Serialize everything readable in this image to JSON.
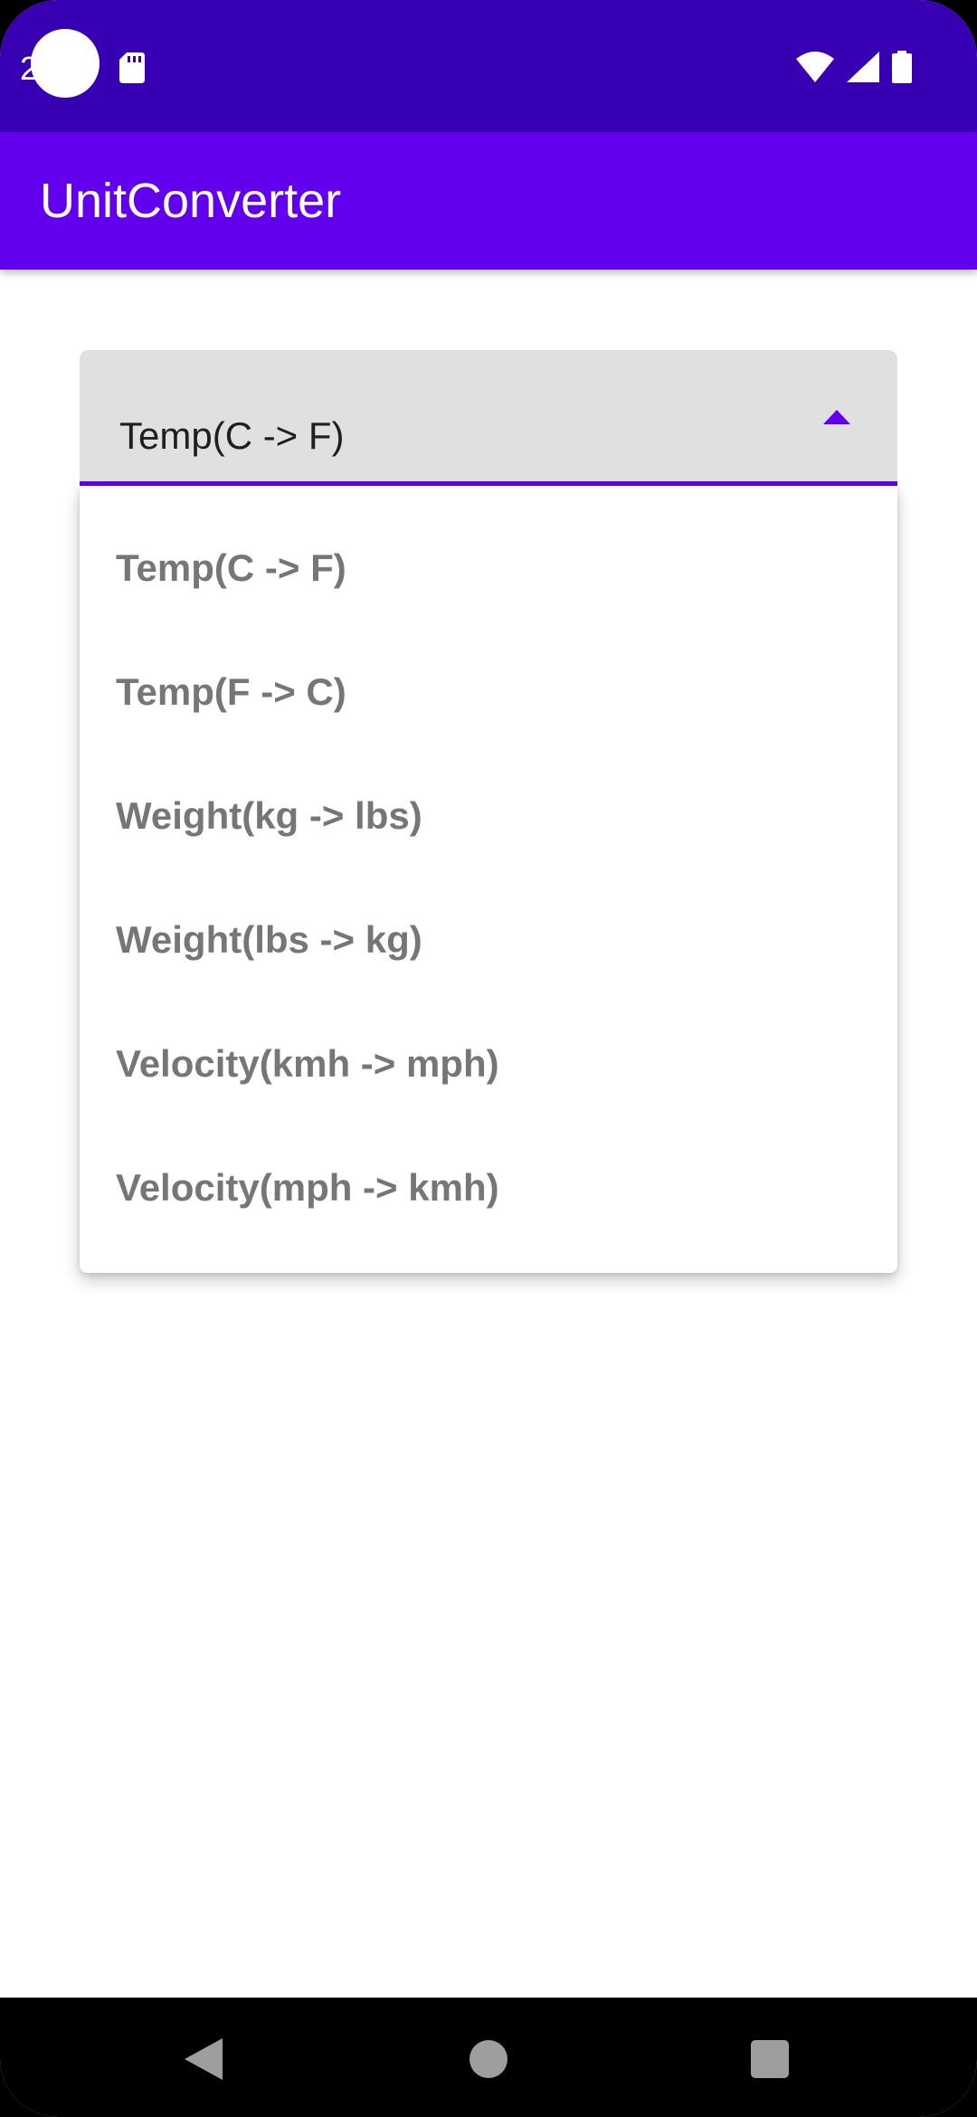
{
  "status_bar": {
    "time": "2",
    "background": "#3700b3",
    "icons": [
      "sd-card-icon",
      "wifi-icon",
      "signal-icon",
      "battery-icon"
    ]
  },
  "app_bar": {
    "title": "UnitConverter",
    "background": "#6200ee"
  },
  "conversion_dropdown": {
    "selected_value": "Temp(C -> F)",
    "expanded": true,
    "accent": "#6200ee",
    "options": [
      "Temp(C -> F)",
      "Temp(F -> C)",
      "Weight(kg -> lbs)",
      "Weight(lbs -> kg)",
      "Velocity(kmh -> mph)",
      "Velocity(mph -> kmh)"
    ]
  },
  "nav_bar": {
    "icons": [
      "back-icon",
      "home-icon",
      "recents-icon"
    ]
  }
}
